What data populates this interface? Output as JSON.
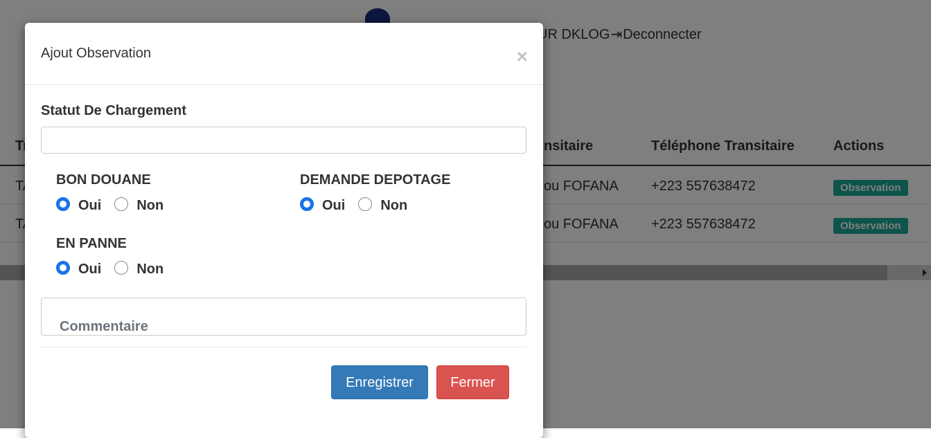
{
  "background": {
    "user_text": "UR DKLOG",
    "logout_label": "Deconnecter",
    "table": {
      "headers": [
        {
          "key": "col1",
          "label": "Tr"
        },
        {
          "key": "col2",
          "label": "nsitaire"
        },
        {
          "key": "col3",
          "label": "Téléphone Transitaire"
        },
        {
          "key": "col4",
          "label": "Actions"
        }
      ],
      "rows": [
        {
          "c1": "TA",
          "c2": "ou FOFANA",
          "c3": "+223 557638472",
          "action": "Observation"
        },
        {
          "c1": "TA",
          "c2": "ou FOFANA",
          "c3": "+223 557638472",
          "action": "Observation"
        }
      ]
    }
  },
  "modal": {
    "title": "Ajout Observation",
    "close_symbol": "×",
    "statut_label": "Statut De Chargement",
    "statut_value": "",
    "groups": {
      "bon_douane": {
        "label": "BON DOUANE",
        "oui": "Oui",
        "non": "Non",
        "selected": "Oui"
      },
      "demande_depotage": {
        "label": "DEMANDE DEPOTAGE",
        "oui": "Oui",
        "non": "Non",
        "selected": "Oui"
      },
      "en_panne": {
        "label": "EN PANNE",
        "oui": "Oui",
        "non": "Non",
        "selected": "Oui"
      }
    },
    "comment_placeholder": "Commentaire",
    "save_label": "Enregistrer",
    "close_label": "Fermer"
  },
  "colors": {
    "primary": "#337ab7",
    "danger": "#d9534f",
    "radio_checked": "#1a73e8",
    "badge": "#1aa897"
  }
}
